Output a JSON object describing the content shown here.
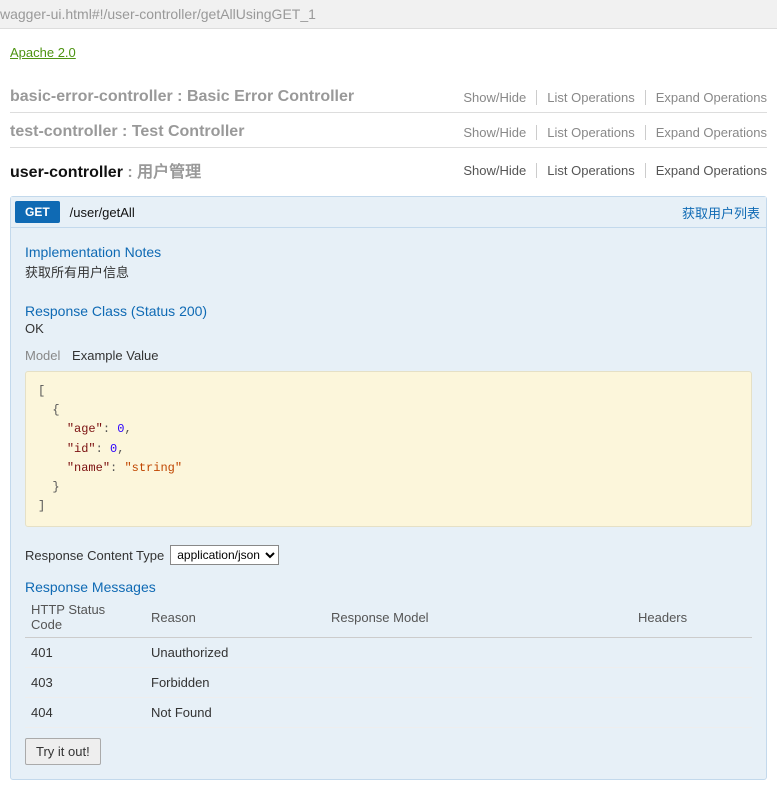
{
  "url_fragment": "wagger-ui.html#!/user-controller/getAllUsingGET_1",
  "license": {
    "label": "Apache 2.0"
  },
  "controllers": [
    {
      "name": "basic-error-controller",
      "desc": "Basic Error Controller",
      "active": false
    },
    {
      "name": "test-controller",
      "desc": "Test Controller",
      "active": false
    },
    {
      "name": "user-controller",
      "desc": "用户管理",
      "active": true
    }
  ],
  "ops_labels": {
    "show_hide": "Show/Hide",
    "list": "List Operations",
    "expand": "Expand Operations"
  },
  "operation": {
    "method": "GET",
    "path": "/user/getAll",
    "summary": "获取用户列表"
  },
  "impl_notes": {
    "heading": "Implementation Notes",
    "text": "获取所有用户信息"
  },
  "response_class": {
    "heading": "Response Class (Status 200)",
    "status_text": "OK"
  },
  "model_switch": {
    "model": "Model",
    "example": "Example Value"
  },
  "content_type": {
    "label": "Response Content Type",
    "selected": "application/json"
  },
  "messages": {
    "heading": "Response Messages",
    "columns": {
      "code": "HTTP Status Code",
      "reason": "Reason",
      "model": "Response Model",
      "headers": "Headers"
    },
    "rows": [
      {
        "code": "401",
        "reason": "Unauthorized",
        "model": "",
        "headers": ""
      },
      {
        "code": "403",
        "reason": "Forbidden",
        "model": "",
        "headers": ""
      },
      {
        "code": "404",
        "reason": "Not Found",
        "model": "",
        "headers": ""
      }
    ]
  },
  "try_button": "Try it out!"
}
